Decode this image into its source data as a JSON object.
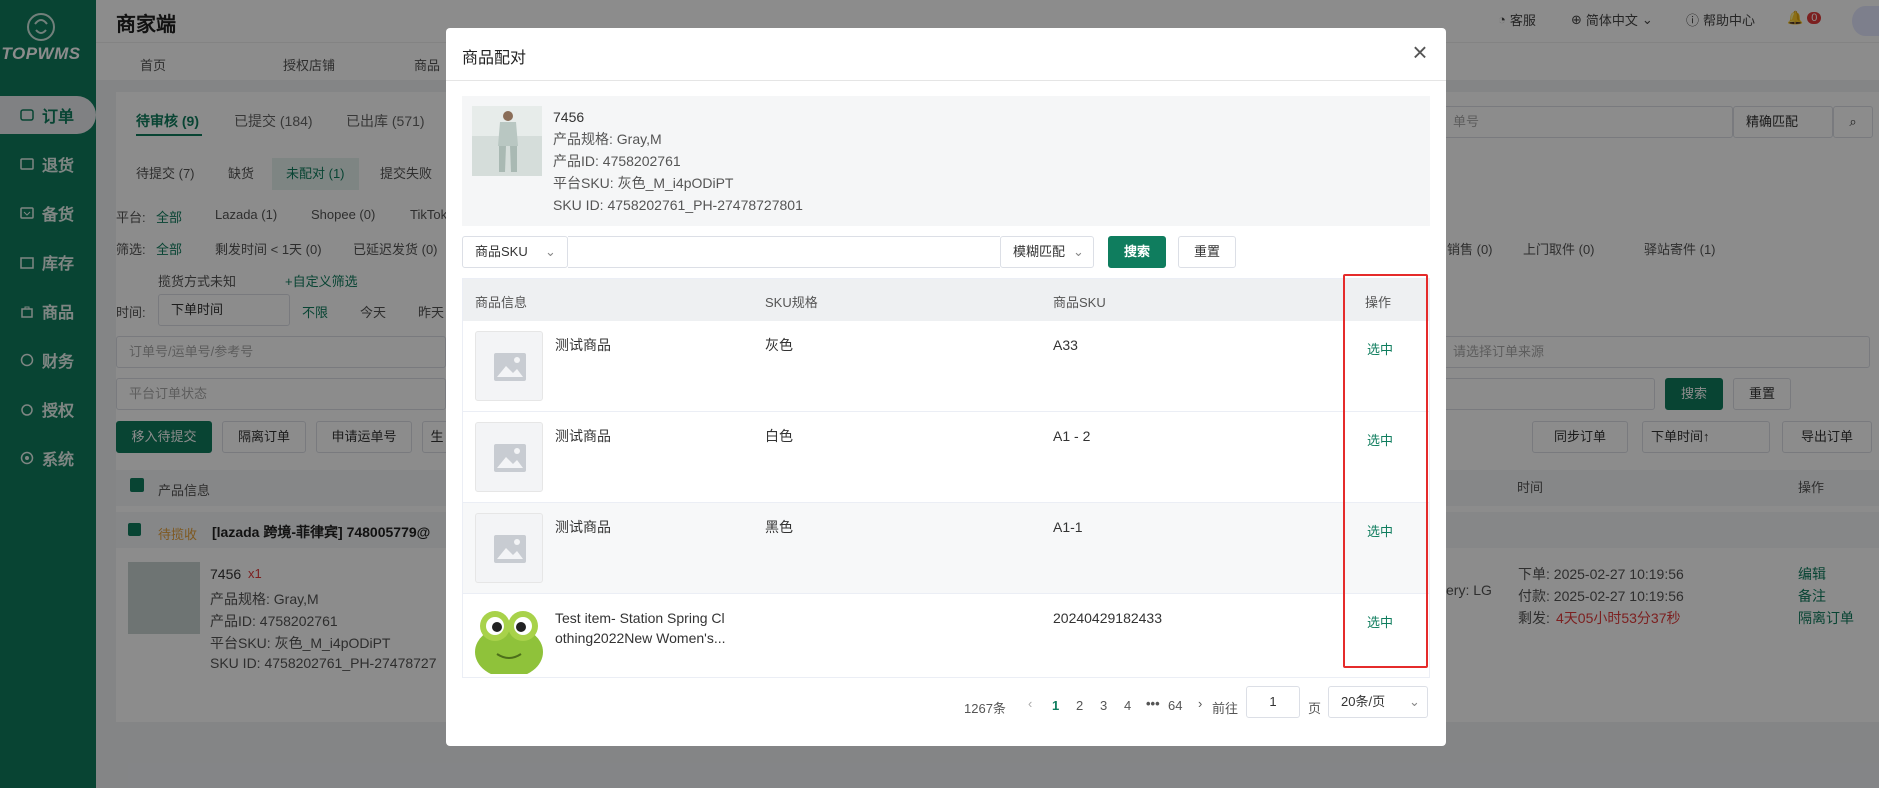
{
  "sidebar": {
    "logo": "TOPWMS",
    "items": [
      {
        "label": "订单",
        "icon": "list-icon"
      },
      {
        "label": "退货",
        "icon": "return-icon"
      },
      {
        "label": "备货",
        "icon": "stock-icon"
      },
      {
        "label": "库存",
        "icon": "warehouse-icon"
      },
      {
        "label": "商品",
        "icon": "bag-icon"
      },
      {
        "label": "财务",
        "icon": "finance-icon"
      },
      {
        "label": "授权",
        "icon": "auth-icon"
      },
      {
        "label": "系统",
        "icon": "gear-icon"
      }
    ]
  },
  "header": {
    "brand": "商家端",
    "service": "客服",
    "language": "简体中文",
    "help": "帮助中心",
    "notifications": "0"
  },
  "nav_tabs": [
    "首页",
    "授权店铺",
    "商品"
  ],
  "status_tabs": [
    "待审核 (9)",
    "已提交 (184)",
    "已出库 (571)"
  ],
  "sub_chips": [
    "待提交 (7)",
    "缺货",
    "未配对 (1)",
    "提交失败"
  ],
  "filters": {
    "platform_label": "平台:",
    "platform_all": "全部",
    "platforms": [
      "Lazada (1)",
      "Shopee (0)",
      "TikTok"
    ],
    "filter_label": "筛选:",
    "filter_all": "全部",
    "filter_items": [
      "剩发时间 < 1天 (0)",
      "已延迟发货 (0)"
    ],
    "pickup_unknown": "揽货方式未知",
    "custom_filter": "+自定义筛选",
    "time_label": "时间:",
    "time_select": "下单时间",
    "time_unlimited": "不限",
    "today": "今天",
    "yesterday": "昨天",
    "right_tags": [
      "销售 (0)",
      "上门取件 (0)",
      "驿站寄件 (1)"
    ],
    "order_search_placeholder": "订单号/运单号/参考号",
    "platform_status_placeholder": "平台订单状态",
    "order_source_placeholder": "请选择订单来源",
    "search_btn": "搜索",
    "reset_btn": "重置",
    "top_search_placeholder": "单号",
    "exact_match": "精确匹配"
  },
  "actions": {
    "move_pending": "移入待提交",
    "isolate": "隔离订单",
    "apply_waybill": "申请运单号",
    "gen": "生",
    "sync_orders": "同步订单",
    "sort_time": "下单时间↑",
    "export": "导出订单"
  },
  "order_table": {
    "col_product": "产品信息",
    "col_time": "时间",
    "col_action": "操作",
    "status_tag": "待揽收",
    "store": "[lazada 跨境-菲律宾] 748005779@",
    "item_name": "7456",
    "qty": "x1",
    "spec": "产品规格:  Gray,M",
    "product_id": "产品ID:  4758202761",
    "platform_sku": "平台SKU:  灰色_M_i4pODiPT",
    "sku_id": "SKU ID:  4758202761_PH-27478727",
    "delivery": "ery: LG",
    "order_time": "下单:  2025-02-27 10:19:56",
    "pay_time": "付款:  2025-02-27 10:19:56",
    "remaining_label": "剩发:",
    "remaining": "4天05小时53分37秒",
    "edit": "编辑",
    "remark": "备注",
    "isolate": "隔离订单"
  },
  "modal": {
    "title": "商品配对",
    "product": {
      "name": "7456",
      "spec": "产品规格:  Gray,M",
      "product_id": "产品ID:  4758202761",
      "platform_sku": "平台SKU:  灰色_M_i4pODiPT",
      "sku_id": "SKU ID:  4758202761_PH-27478727801"
    },
    "search": {
      "field_select": "商品SKU",
      "input_value": "",
      "match_select": "模糊匹配",
      "search_btn": "搜索",
      "reset_btn": "重置"
    },
    "table": {
      "headers": [
        "商品信息",
        "SKU规格",
        "商品SKU",
        "操作"
      ],
      "rows": [
        {
          "name": "测试商品",
          "spec": "灰色",
          "sku": "A33",
          "action": "选中",
          "image": "placeholder"
        },
        {
          "name": "测试商品",
          "spec": "白色",
          "sku": "A1 - 2",
          "action": "选中",
          "image": "placeholder"
        },
        {
          "name": "测试商品",
          "spec": "黑色",
          "sku": "A1-1",
          "action": "选中",
          "image": "placeholder"
        },
        {
          "name": "Test item- Station Spring Cl othing2022New Women's...",
          "spec": "",
          "sku": "20240429182433",
          "action": "选中",
          "image": "frog"
        }
      ]
    },
    "pagination": {
      "total": "1267条",
      "pages": [
        "1",
        "2",
        "3",
        "4",
        "64"
      ],
      "current": "1",
      "goto_label": "前往",
      "goto_value": "1",
      "page_unit": "页",
      "page_size": "20条/页"
    }
  },
  "colors": {
    "brand": "#0f7d5e",
    "highlight": "#e52b2b",
    "alert": "#e23b3b"
  }
}
